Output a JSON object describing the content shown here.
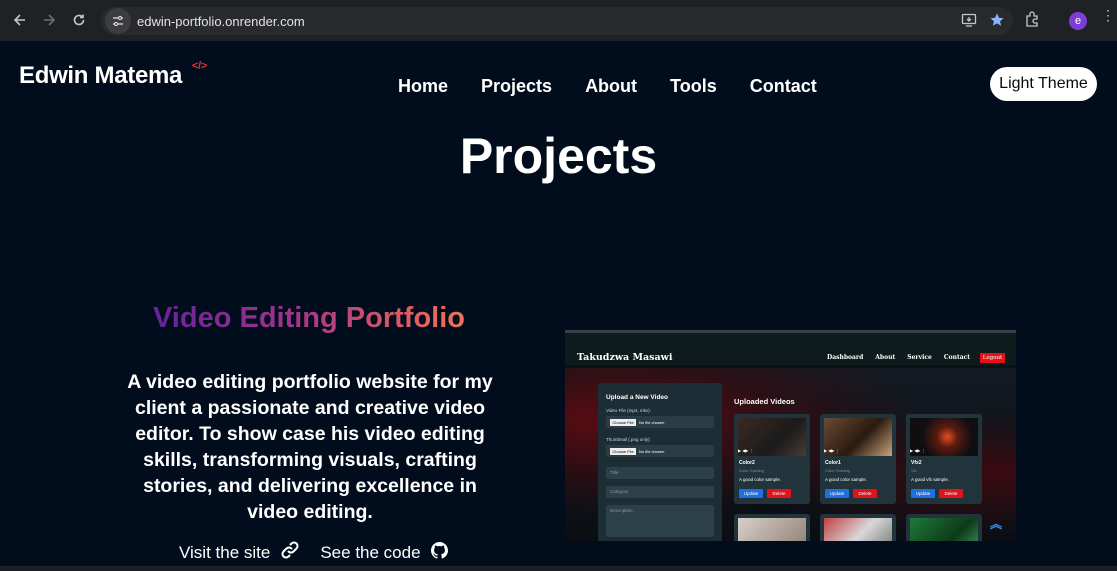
{
  "browser": {
    "url": "edwin-portfolio.onrender.com",
    "profile_initial": "e"
  },
  "site": {
    "logo": "Edwin Matema",
    "logo_tag": "</>",
    "nav": [
      "Home",
      "Projects",
      "About",
      "Tools",
      "Contact"
    ],
    "theme_button": "Light Theme"
  },
  "section": {
    "title": "Projects"
  },
  "project": {
    "title": "Video Editing Portfolio",
    "description": "A video editing portfolio website for my client a passionate and creative video editor. To show case his video editing skills, transforming visuals, crafting stories, and delivering excellence in video editing.",
    "visit_label": "Visit the site",
    "code_label": "See the code"
  },
  "preview": {
    "brand": "Takudzwa Masawi",
    "nav": [
      "Dashboard",
      "About",
      "Service",
      "Contact"
    ],
    "logout": "Logout",
    "upload_heading": "Upload a New Video",
    "video_file_label": "Video File (mp4, mkv):",
    "thumbnail_label": "Thumbnail (.png only):",
    "choose_file": "Choose File",
    "no_file": "No file chosen",
    "title_placeholder": "Title",
    "category_placeholder": "Category",
    "description_placeholder": "Description",
    "uploaded_heading": "Uploaded Videos",
    "cards": [
      {
        "title": "Color2",
        "category": "Color Grading",
        "desc": "A good color sample.",
        "update": "Update",
        "delete": "Delete"
      },
      {
        "title": "Color1",
        "category": "Color Grading",
        "desc": "A good color sample.",
        "update": "Update",
        "delete": "Delete"
      },
      {
        "title": "Vfx2",
        "category": "Vfx",
        "desc": "A good vfx sample.",
        "update": "Update",
        "delete": "Delete"
      }
    ]
  }
}
